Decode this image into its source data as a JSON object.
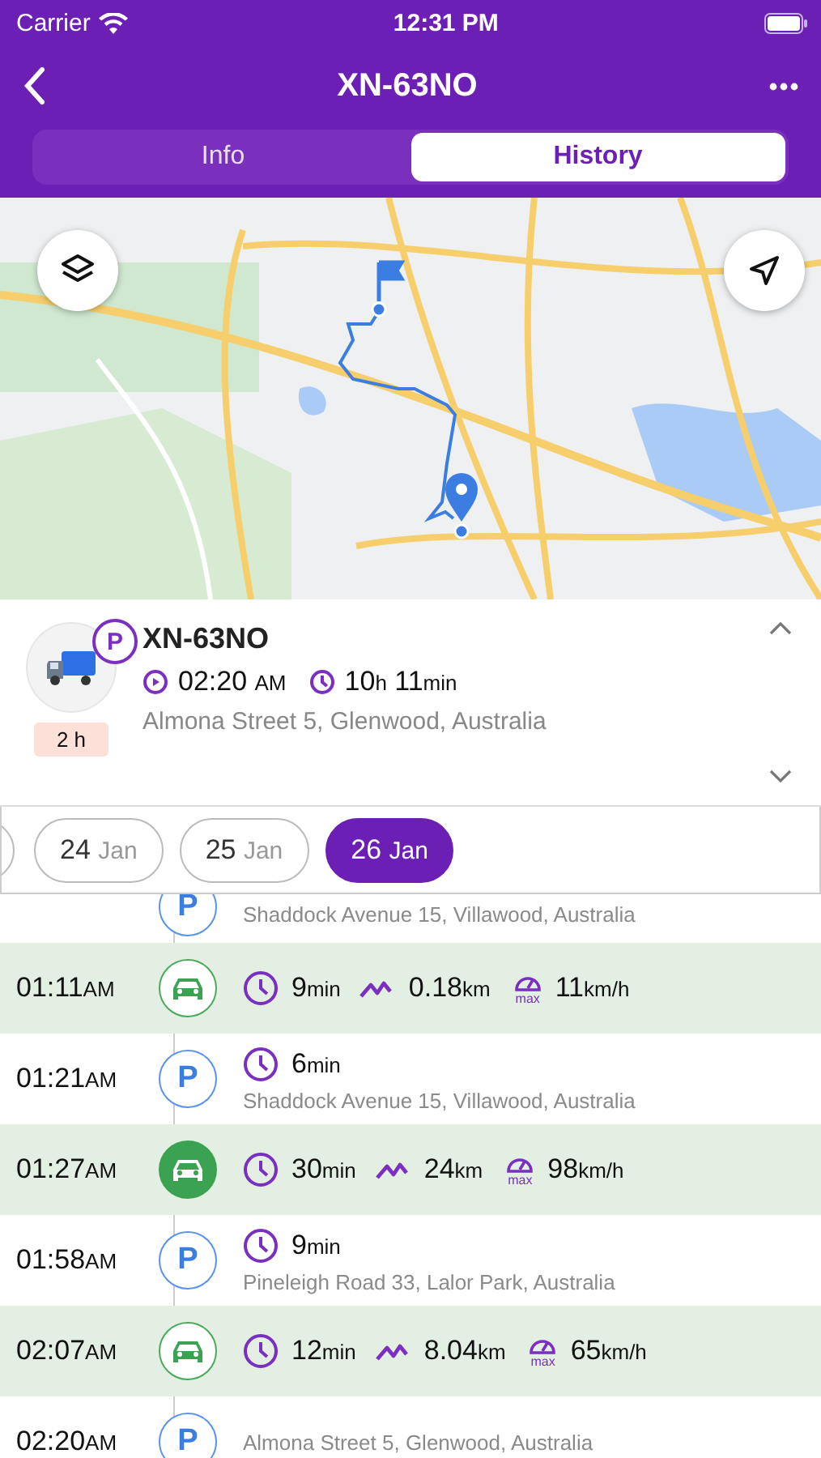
{
  "status_bar": {
    "carrier": "Carrier",
    "time": "12:31 PM"
  },
  "nav": {
    "title": "XN-63NO"
  },
  "tabs": [
    {
      "label": "Info",
      "selected": false
    },
    {
      "label": "History",
      "selected": true
    }
  ],
  "vehicle": {
    "name": "XN-63NO",
    "badge": "P",
    "duration_badge": "2 h",
    "start_time": "02:20",
    "start_period": "AM",
    "elapsed": [
      {
        "value": "10",
        "unit": "h"
      },
      {
        "value": "11",
        "unit": "min"
      }
    ],
    "address": "Almona Street 5, Glenwood, Australia",
    "expanded": true
  },
  "dates": [
    {
      "day": "24",
      "month": "Jan",
      "selected": false
    },
    {
      "day": "25",
      "month": "Jan",
      "selected": false
    },
    {
      "day": "26",
      "month": "Jan",
      "selected": true
    }
  ],
  "timeline": [
    {
      "kind": "parking",
      "marker": "P",
      "address": "Shaddock Avenue 15, Villawood, Australia"
    },
    {
      "kind": "driving",
      "selected": false,
      "time": "01:11",
      "period": "AM",
      "duration": {
        "value": "9",
        "unit": "min"
      },
      "distance": {
        "value": "0.18",
        "unit": "km"
      },
      "max_speed": {
        "value": "11",
        "unit": "km/h"
      },
      "max_label": "max"
    },
    {
      "kind": "parking",
      "marker": "P",
      "time": "01:21",
      "period": "AM",
      "duration": {
        "value": "6",
        "unit": "min"
      },
      "address": "Shaddock Avenue 15, Villawood, Australia"
    },
    {
      "kind": "driving",
      "selected": true,
      "time": "01:27",
      "period": "AM",
      "duration": {
        "value": "30",
        "unit": "min"
      },
      "distance": {
        "value": "24",
        "unit": "km"
      },
      "max_speed": {
        "value": "98",
        "unit": "km/h"
      },
      "max_label": "max"
    },
    {
      "kind": "parking",
      "marker": "P",
      "time": "01:58",
      "period": "AM",
      "duration": {
        "value": "9",
        "unit": "min"
      },
      "address": "Pineleigh Road 33, Lalor Park, Australia"
    },
    {
      "kind": "driving",
      "selected": false,
      "time": "02:07",
      "period": "AM",
      "duration": {
        "value": "12",
        "unit": "min"
      },
      "distance": {
        "value": "8.04",
        "unit": "km"
      },
      "max_speed": {
        "value": "65",
        "unit": "km/h"
      },
      "max_label": "max"
    },
    {
      "kind": "parking",
      "marker": "P",
      "time": "02:20",
      "period": "AM",
      "address": "Almona Street 5, Glenwood, Australia"
    }
  ]
}
